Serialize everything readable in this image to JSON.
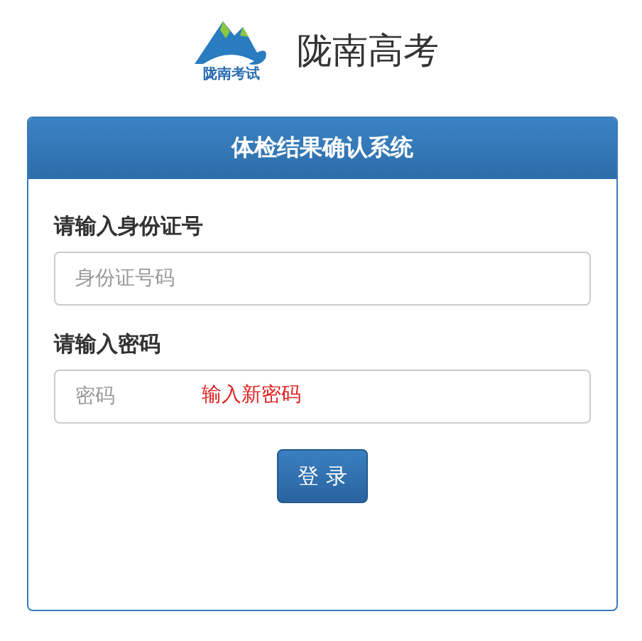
{
  "header": {
    "logo_text": "陇南考试",
    "title": "陇南高考"
  },
  "panel": {
    "title": "体检结果确认系统",
    "fields": [
      {
        "label": "请输入身份证号",
        "placeholder": "身份证号码"
      },
      {
        "label": "请输入密码",
        "placeholder": "密码",
        "note": "输入新密码"
      }
    ],
    "button": "登 录"
  }
}
